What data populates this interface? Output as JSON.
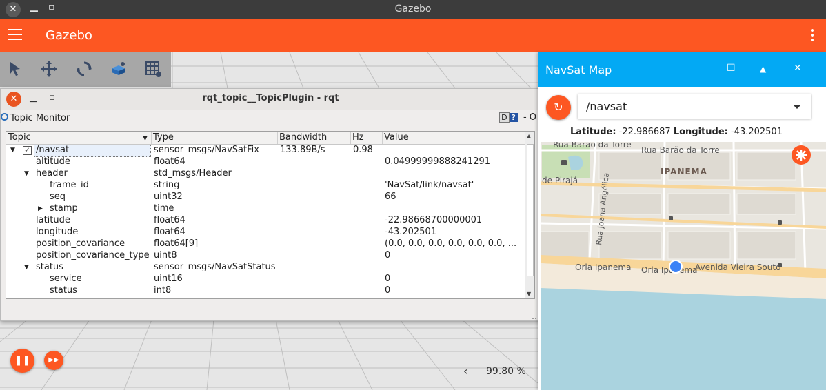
{
  "window": {
    "title": "Gazebo"
  },
  "app": {
    "title": "Gazebo"
  },
  "rqt": {
    "title": "rqt_topic__TopicPlugin - rqt",
    "panel_title": "Topic Monitor",
    "help_d": "D",
    "help_q": "?",
    "panel_controls": "- O",
    "columns": [
      "Topic",
      "Type",
      "Bandwidth",
      "Hz",
      "Value"
    ],
    "rows": [
      {
        "topic": "/navsat",
        "type": "sensor_msgs/NavSatFix",
        "bandwidth": "133.89B/s",
        "hz": "0.98",
        "value": ""
      },
      {
        "topic": "altitude",
        "type": "float64",
        "bandwidth": "",
        "hz": "",
        "value": "0.04999999888241291"
      },
      {
        "topic": "header",
        "type": "std_msgs/Header",
        "bandwidth": "",
        "hz": "",
        "value": ""
      },
      {
        "topic": "frame_id",
        "type": "string",
        "bandwidth": "",
        "hz": "",
        "value": "'NavSat/link/navsat'"
      },
      {
        "topic": "seq",
        "type": "uint32",
        "bandwidth": "",
        "hz": "",
        "value": "66"
      },
      {
        "topic": "stamp",
        "type": "time",
        "bandwidth": "",
        "hz": "",
        "value": ""
      },
      {
        "topic": "latitude",
        "type": "float64",
        "bandwidth": "",
        "hz": "",
        "value": "-22.98668700000001"
      },
      {
        "topic": "longitude",
        "type": "float64",
        "bandwidth": "",
        "hz": "",
        "value": "-43.202501"
      },
      {
        "topic": "position_covariance",
        "type": "float64[9]",
        "bandwidth": "",
        "hz": "",
        "value": "(0.0, 0.0, 0.0, 0.0, 0.0, 0.0, ..."
      },
      {
        "topic": "position_covariance_type",
        "type": "uint8",
        "bandwidth": "",
        "hz": "",
        "value": "0"
      },
      {
        "topic": "status",
        "type": "sensor_msgs/NavSatStatus",
        "bandwidth": "",
        "hz": "",
        "value": ""
      },
      {
        "topic": "service",
        "type": "uint16",
        "bandwidth": "",
        "hz": "",
        "value": "0"
      },
      {
        "topic": "status",
        "type": "int8",
        "bandwidth": "",
        "hz": "",
        "value": "0"
      }
    ]
  },
  "navsat": {
    "title": "NavSat Map",
    "topic": "/navsat",
    "lat_label": "Latitude:",
    "lat_value": "-22.986687",
    "lon_label": "Longitude:",
    "lon_value": "-43.202501",
    "map_labels": {
      "street1": "Rua Barão da Torre",
      "street2": "Rua Barão da Torre",
      "district": "IPANEMA",
      "piraja": "de Pirajá",
      "joana": "Rua Joana Angélica",
      "orla1": "Orla Ipanema",
      "orla2": "Orla Ipanema",
      "vieira": "Avenida Vieira Souto"
    }
  },
  "controls": {
    "rtf": "99.80 %"
  },
  "colors": {
    "accent": "#fd5722",
    "navsat_header": "#03a9f4",
    "map_land": "#e9e6df",
    "map_water": "#aad3df",
    "map_road": "#f8d699"
  }
}
